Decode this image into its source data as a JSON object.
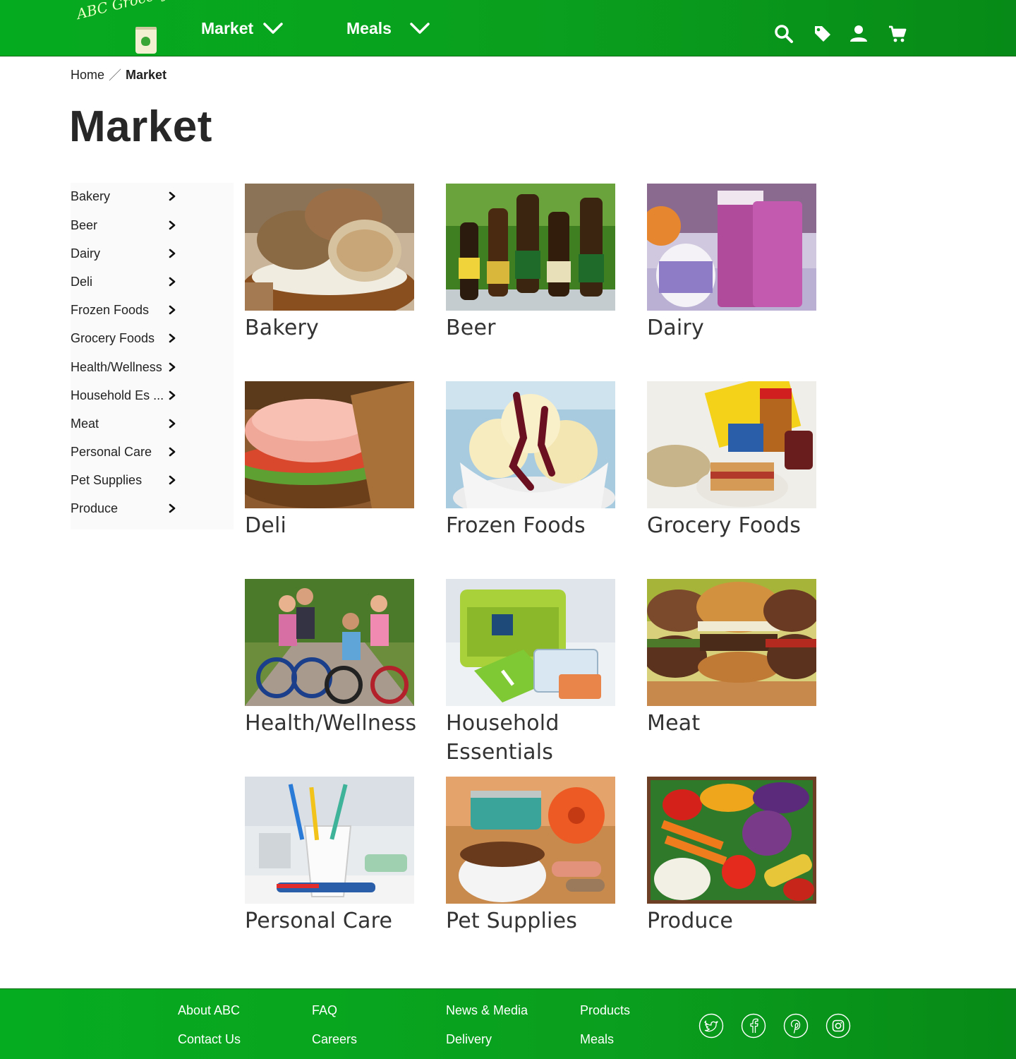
{
  "header": {
    "logo_text": "ABC Grocery",
    "nav": [
      {
        "label": "Market"
      },
      {
        "label": "Meals"
      }
    ],
    "icons": [
      "search-icon",
      "tag-icon",
      "user-icon",
      "cart-icon"
    ]
  },
  "breadcrumb": {
    "home": "Home",
    "separator": "／",
    "current": "Market"
  },
  "page": {
    "title": "Market"
  },
  "sidebar": {
    "items": [
      {
        "label": "Bakery"
      },
      {
        "label": "Beer"
      },
      {
        "label": "Dairy"
      },
      {
        "label": "Deli"
      },
      {
        "label": "Frozen Foods"
      },
      {
        "label": "Grocery Foods"
      },
      {
        "label": "Health/Wellness"
      },
      {
        "label": "Household Es ..."
      },
      {
        "label": "Meat"
      },
      {
        "label": "Personal Care"
      },
      {
        "label": "Pet Supplies"
      },
      {
        "label": "Produce"
      }
    ]
  },
  "categories": [
    {
      "label": "Bakery"
    },
    {
      "label": "Beer"
    },
    {
      "label": "Dairy"
    },
    {
      "label": "Deli"
    },
    {
      "label": "Frozen Foods"
    },
    {
      "label": "Grocery Foods"
    },
    {
      "label": "Health/Wellness"
    },
    {
      "label": "Household Essentials"
    },
    {
      "label": "Meat"
    },
    {
      "label": "Personal Care"
    },
    {
      "label": "Pet Supplies"
    },
    {
      "label": "Produce"
    }
  ],
  "footer": {
    "links": [
      {
        "label": "About ABC"
      },
      {
        "label": "Contact Us"
      },
      {
        "label": "FAQ"
      },
      {
        "label": "Careers"
      },
      {
        "label": "News & Media"
      },
      {
        "label": "Delivery"
      },
      {
        "label": "Products"
      },
      {
        "label": "Meals"
      }
    ],
    "social": [
      "twitter-icon",
      "facebook-icon",
      "pinterest-icon",
      "instagram-icon"
    ]
  },
  "colors": {
    "brand_green": "#0a9f1e",
    "text_dark": "#222222",
    "sidebar_bg": "#fafafa"
  }
}
